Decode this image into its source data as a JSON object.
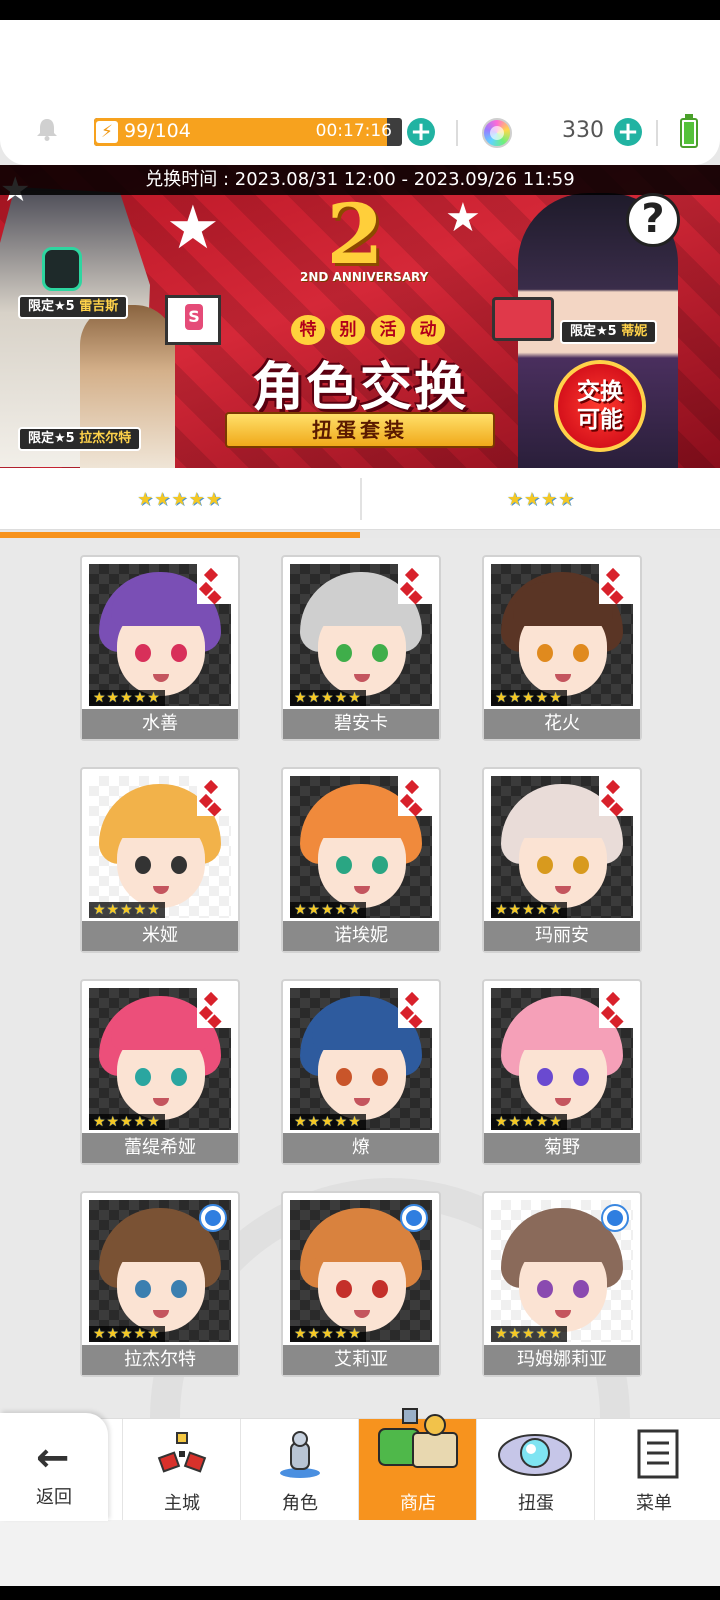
{
  "status_bar": {
    "stamina_value": "99/104",
    "stamina_fraction": 0.952,
    "stamina_timer": "00:17:16",
    "gem_count": "330",
    "icons": [
      "bell-icon",
      "lightning-icon",
      "plus-icon",
      "rainbow-gem-icon",
      "battery-icon"
    ]
  },
  "banner": {
    "exchange_period": "兑换时间 : 2023.08/31 12:00 - 2023.09/26 11:59",
    "anniversary_number": "2",
    "anniversary_text": "2ND ANNIVERSARY",
    "special_event_chars": [
      "特",
      "别",
      "活",
      "动"
    ],
    "title": "角色交换",
    "ribbon": "扭蛋套装",
    "badge_line1": "交换",
    "badge_line2": "可能",
    "tag_limited": "限定★5",
    "tag_names": [
      "雷吉斯",
      "拉杰尔特",
      "蒂妮"
    ],
    "help_symbol": "?"
  },
  "tabs": [
    {
      "stars": "★★★★★",
      "rarity": 5,
      "selected": true
    },
    {
      "stars": "★★★★",
      "rarity": 4,
      "selected": false
    }
  ],
  "characters": [
    {
      "name": "水善",
      "stars": "★★★★★",
      "badge": "diamond",
      "hair": "#7a4fb5",
      "eye": "#d8305a",
      "bg": "dark"
    },
    {
      "name": "碧安卡",
      "stars": "★★★★★",
      "badge": "diamond",
      "hair": "#cfcfcf",
      "eye": "#3fae4a",
      "bg": "dark"
    },
    {
      "name": "花火",
      "stars": "★★★★★",
      "badge": "diamond",
      "hair": "#5a3525",
      "eye": "#e08a1e",
      "bg": "dark"
    },
    {
      "name": "米娅",
      "stars": "★★★★★",
      "badge": "diamond",
      "hair": "#f2b24a",
      "eye": "#333333",
      "bg": "light"
    },
    {
      "name": "诺埃妮",
      "stars": "★★★★★",
      "badge": "diamond",
      "hair": "#f08a3c",
      "eye": "#2aa683",
      "bg": "dark"
    },
    {
      "name": "玛丽安",
      "stars": "★★★★★",
      "badge": "diamond",
      "hair": "#e9dcd8",
      "eye": "#d89a1e",
      "bg": "dark"
    },
    {
      "name": "蕾缇希娅",
      "stars": "★★★★★",
      "badge": "diamond",
      "hair": "#ec4f7a",
      "eye": "#2aa6a0",
      "bg": "dark"
    },
    {
      "name": "燎",
      "stars": "★★★★★",
      "badge": "diamond",
      "hair": "#2e5b9e",
      "eye": "#c9552a",
      "bg": "dark"
    },
    {
      "name": "菊野",
      "stars": "★★★★★",
      "badge": "diamond",
      "hair": "#f5a0b8",
      "eye": "#6a4ad0",
      "bg": "dark"
    },
    {
      "name": "拉杰尔特",
      "stars": "★★★★★",
      "badge": "dot",
      "hair": "#7a5234",
      "eye": "#3b7fb0",
      "bg": "dark"
    },
    {
      "name": "艾莉亚",
      "stars": "★★★★★",
      "badge": "dot",
      "hair": "#d9823e",
      "eye": "#c4302a",
      "bg": "dark"
    },
    {
      "name": "玛姆娜莉亚",
      "stars": "★★★★★",
      "badge": "dot",
      "hair": "#8a6a5a",
      "eye": "#8a4ab0",
      "bg": "light"
    }
  ],
  "nav": {
    "back_label": "返回",
    "items": [
      {
        "label": "主城",
        "icon": "castle-icon"
      },
      {
        "label": "角色",
        "icon": "character-icon"
      },
      {
        "label": "商店",
        "icon": "shop-icon",
        "active": true
      },
      {
        "label": "扭蛋",
        "icon": "gacha-icon"
      },
      {
        "label": "菜单",
        "icon": "menu-icon"
      }
    ]
  },
  "colors": {
    "accent": "#f7931e",
    "plus_button": "#21b3a2",
    "card_name_bg": "#8a8a8a",
    "banner_red": "#c41e2e"
  }
}
